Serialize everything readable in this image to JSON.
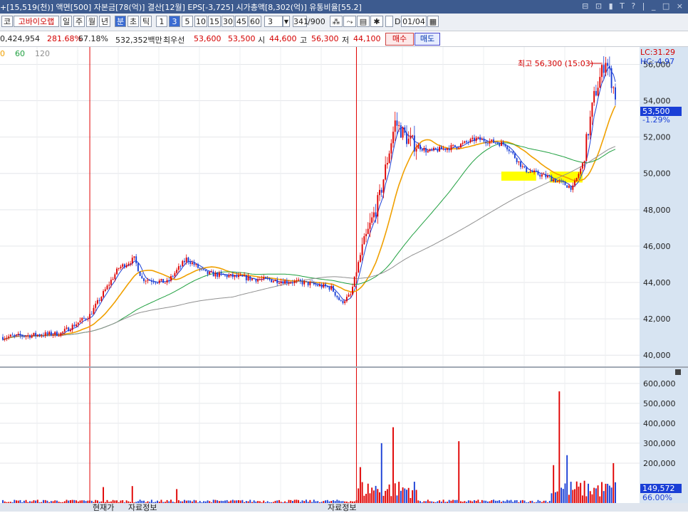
{
  "window": {
    "title": "+[15,519(천)] 액면[500] 자본금[78(억)] 결산[12월] EPS[-3,725] 시가총액[8,302(억)] 유통비율[55.2]",
    "controls": "⊟ ⊡ ▮ T ? | _ □ ×"
  },
  "toolbar": {
    "market": "코",
    "stock_name": "고바이오랩",
    "periods": [
      "일",
      "주",
      "월",
      "년",
      "분",
      "초",
      "틱"
    ],
    "selected_period": "분",
    "intervals": [
      "1",
      "3",
      "5",
      "10",
      "15",
      "30",
      "45",
      "60"
    ],
    "selected_interval": "3",
    "interval_select": "3",
    "count": "341",
    "count_total": "/900",
    "date_label": "D",
    "date_value": "01/04"
  },
  "info": {
    "volume": "0,424,954",
    "volume_rate": "281.68%",
    "turnover_rate": "67.18%",
    "trade_amount": "532,352백만",
    "best_ask_label": "최우선",
    "best_ask": "53,600",
    "best_bid": "53,500",
    "open_label": "시",
    "open": "44,600",
    "high_label": "고",
    "high": "56,300",
    "low_label": "저",
    "low": "44,100",
    "buy_label": "매수",
    "sell_label": "매도"
  },
  "status": {
    "tab1": "현재가",
    "tab2": "자료정보",
    "tab3": "자료정보"
  },
  "colors": {
    "up": "#e00000",
    "down": "#1a3fd6",
    "ma5": "#1a3fd6",
    "ma20": "#f0a000",
    "ma60": "#20a040",
    "ma120": "#909090",
    "highlight": "#ffff00",
    "axis_panel": "#d7e4f2"
  },
  "chart_data": [
    {
      "type": "candlestick",
      "legend": [
        {
          "label": "0",
          "color": "#f0a000"
        },
        {
          "label": "60",
          "color": "#20a040"
        },
        {
          "label": "120",
          "color": "#909090"
        }
      ],
      "ylim": [
        39500,
        56800
      ],
      "y_ticks": [
        "56,000",
        "54,000",
        "52,000",
        "50,000",
        "48,000",
        "46,000",
        "44,000",
        "42,000",
        "40,000"
      ],
      "lc_label": "LC:31.29",
      "hc_label": "HC:-4.97",
      "current_price": "53,500",
      "change_pct": "-1.29%",
      "annotation": "최고 56,300 (15:03)",
      "anchors": [
        {
          "i": 0,
          "v": 41000
        },
        {
          "i": 30,
          "v": 41200
        },
        {
          "i": 45,
          "v": 42200
        },
        {
          "i": 60,
          "v": 44800
        },
        {
          "i": 68,
          "v": 45300
        },
        {
          "i": 72,
          "v": 44200
        },
        {
          "i": 85,
          "v": 44000
        },
        {
          "i": 95,
          "v": 45300
        },
        {
          "i": 105,
          "v": 44500
        },
        {
          "i": 130,
          "v": 44200
        },
        {
          "i": 155,
          "v": 44000
        },
        {
          "i": 170,
          "v": 43700
        },
        {
          "i": 175,
          "v": 42900
        },
        {
          "i": 180,
          "v": 43300
        },
        {
          "i": 185,
          "v": 45500
        },
        {
          "i": 195,
          "v": 48700
        },
        {
          "i": 203,
          "v": 52800
        },
        {
          "i": 210,
          "v": 51800
        },
        {
          "i": 220,
          "v": 51200
        },
        {
          "i": 235,
          "v": 51500
        },
        {
          "i": 245,
          "v": 51900
        },
        {
          "i": 260,
          "v": 51600
        },
        {
          "i": 270,
          "v": 50200
        },
        {
          "i": 282,
          "v": 49800
        },
        {
          "i": 295,
          "v": 49200
        },
        {
          "i": 300,
          "v": 50500
        },
        {
          "i": 306,
          "v": 54200
        },
        {
          "i": 312,
          "v": 56300
        },
        {
          "i": 317,
          "v": 54300
        }
      ],
      "bars": 318,
      "vertical_markers": [
        45,
        183
      ],
      "highlight_boxes": [
        {
          "i0": 258,
          "i1": 276,
          "v0": 49600,
          "v1": 50100
        },
        {
          "i0": 283,
          "i1": 300,
          "v0": 49500,
          "v1": 50100
        }
      ]
    },
    {
      "type": "bar",
      "name": "volume",
      "ylim": [
        0,
        660000
      ],
      "y_ticks": [
        "600,000",
        "500,000",
        "400,000",
        "300,000",
        "200,000"
      ],
      "current_volume": "149,572",
      "volume_pct": "66.00%",
      "spikes": [
        {
          "i": 52,
          "v": 80000
        },
        {
          "i": 67,
          "v": 85000
        },
        {
          "i": 90,
          "v": 70000
        },
        {
          "i": 185,
          "v": 180000
        },
        {
          "i": 196,
          "v": 300000
        },
        {
          "i": 202,
          "v": 380000
        },
        {
          "i": 236,
          "v": 310000
        },
        {
          "i": 285,
          "v": 190000
        },
        {
          "i": 288,
          "v": 560000
        },
        {
          "i": 292,
          "v": 240000
        },
        {
          "i": 316,
          "v": 200000
        }
      ]
    }
  ]
}
